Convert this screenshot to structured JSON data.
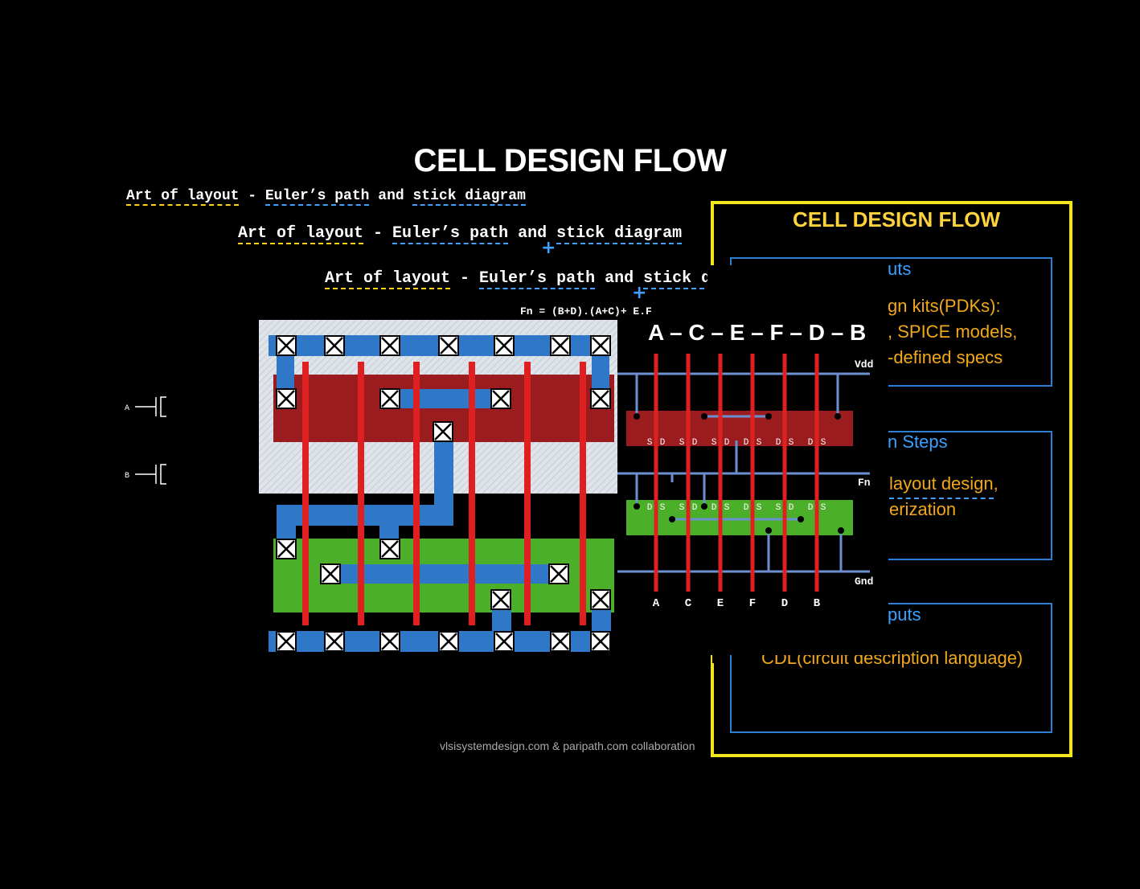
{
  "title": "CELL DESIGN FLOW",
  "headings": {
    "art": "Art of layout",
    "dash": " - ",
    "euler": "Euler’s path",
    "and": " and ",
    "stick": "stick diagram"
  },
  "formula": "Fn = (B+D).(A+C)+ E.F",
  "plus": "+",
  "euler_path": "A – C – E – F – D – B",
  "rails": {
    "vdd": "Vdd",
    "fn": "Fn",
    "gnd": "Gnd"
  },
  "gate_labels": [
    "A",
    "C",
    "E",
    "F",
    "D",
    "B"
  ],
  "pmos_sd": [
    "S",
    "D",
    "S",
    "D",
    "S",
    "D",
    "D",
    "S",
    "D",
    "S",
    "D",
    "S"
  ],
  "nmos_sd": [
    "D",
    "S",
    "S",
    "D",
    "D",
    "S",
    "D",
    "S",
    "S",
    "D",
    "D",
    "S"
  ],
  "schematic_inputs": [
    "A",
    "B"
  ],
  "panel": {
    "title": "CELL DESIGN FLOW",
    "inputs_title": "uts",
    "inputs_line1": "gn kits(PDKs):",
    "inputs_line2": ", SPICE models,",
    "inputs_line3": "-defined specs",
    "steps_title": "n Steps",
    "steps_line1": "layout design,",
    "steps_line2": "erization",
    "outputs_title": "puts",
    "outputs_line1": "CDL(circuit description language)"
  },
  "credit": "vlsisystemdesign.com & paripath.com collaboration",
  "colors": {
    "pdiff": "#9a1c1e",
    "ndiff": "#4caf2a",
    "metal": "#2f78c8",
    "poly": "#e02020",
    "frame": "#f2e51e"
  }
}
